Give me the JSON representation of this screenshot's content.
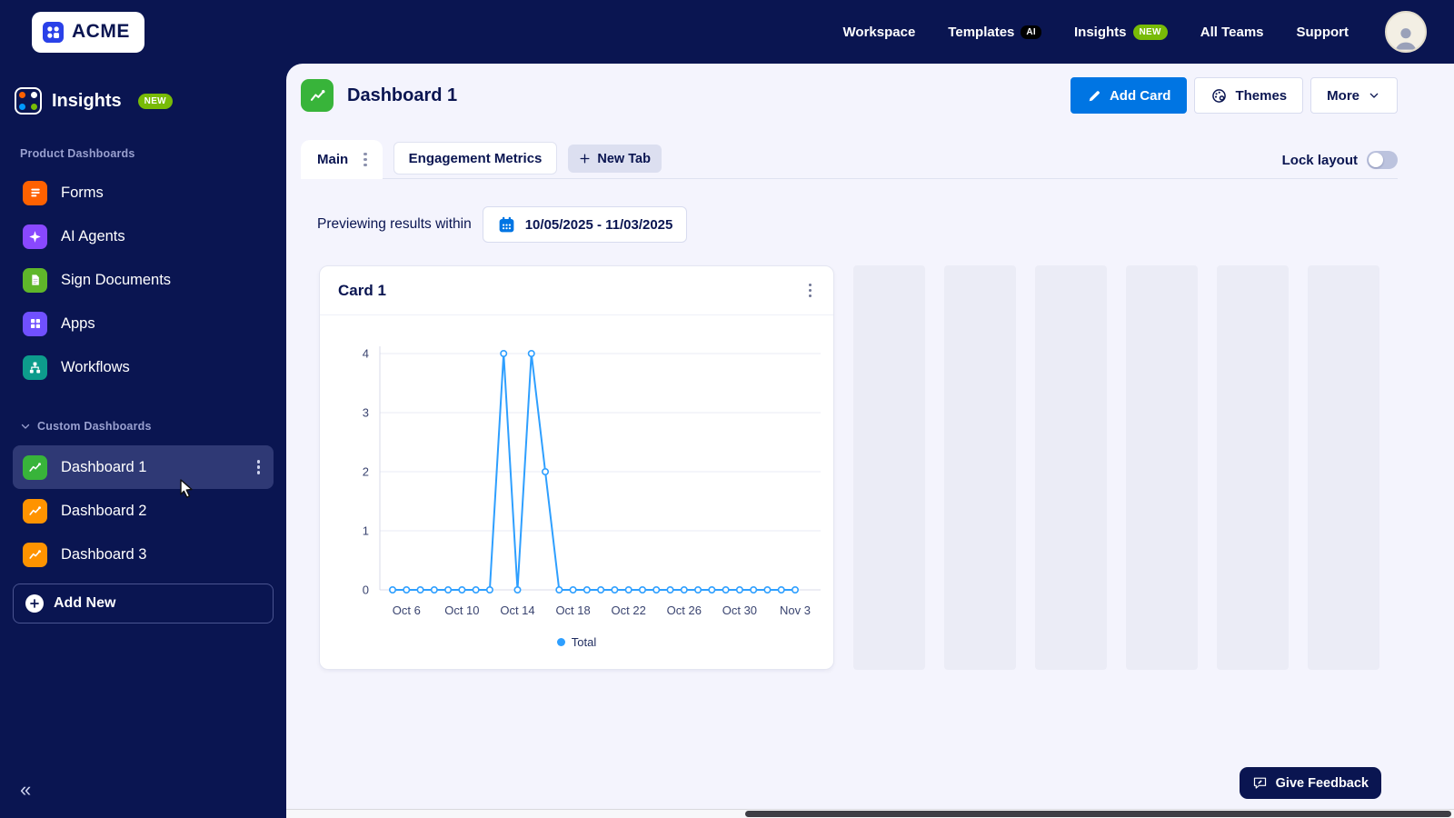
{
  "topbar": {
    "brand": "ACME",
    "nav": [
      {
        "label": "Workspace"
      },
      {
        "label": "Templates",
        "badge": "AI"
      },
      {
        "label": "Insights",
        "badge": "NEW"
      },
      {
        "label": "All Teams"
      },
      {
        "label": "Support"
      }
    ]
  },
  "sidebar": {
    "product": "Insights",
    "product_badge": "NEW",
    "section1": "Product Dashboards",
    "items": [
      {
        "label": "Forms",
        "icon": "forms-icon",
        "color": "#ff6100"
      },
      {
        "label": "AI Agents",
        "icon": "ai-agents-icon",
        "color": "#8948ff"
      },
      {
        "label": "Sign Documents",
        "icon": "sign-documents-icon",
        "color": "#5fb62a"
      },
      {
        "label": "Apps",
        "icon": "apps-icon",
        "color": "#7050ff"
      },
      {
        "label": "Workflows",
        "icon": "workflows-icon",
        "color": "#0d9c8c"
      }
    ],
    "section2": "Custom Dashboards",
    "dashboards": [
      {
        "label": "Dashboard 1",
        "icon": "dashboard-icon",
        "color": "#38b43a",
        "active": true
      },
      {
        "label": "Dashboard 2",
        "icon": "dashboard-icon",
        "color": "#ff9300",
        "active": false
      },
      {
        "label": "Dashboard 3",
        "icon": "dashboard-icon",
        "color": "#ff9300",
        "active": false
      }
    ],
    "add_new": "Add New",
    "collapse": "«"
  },
  "header": {
    "title": "Dashboard 1",
    "icon_color": "#38b43a",
    "add_card": "Add Card",
    "themes": "Themes",
    "more": "More"
  },
  "tabs": {
    "main_label": "Main",
    "metrics_label": "Engagement Metrics",
    "new_tab_label": "New Tab",
    "lock_label": "Lock layout",
    "lock_on": false
  },
  "preview": {
    "label": "Previewing results within",
    "date_range": "10/05/2025 - 11/03/2025"
  },
  "card": {
    "title": "Card 1"
  },
  "chart_data": {
    "type": "line",
    "title": "Card 1",
    "x": [
      "Oct 5",
      "Oct 6",
      "Oct 7",
      "Oct 8",
      "Oct 9",
      "Oct 10",
      "Oct 11",
      "Oct 12",
      "Oct 13",
      "Oct 14",
      "Oct 15",
      "Oct 16",
      "Oct 17",
      "Oct 18",
      "Oct 19",
      "Oct 20",
      "Oct 21",
      "Oct 22",
      "Oct 23",
      "Oct 24",
      "Oct 25",
      "Oct 26",
      "Oct 27",
      "Oct 28",
      "Oct 29",
      "Oct 30",
      "Oct 31",
      "Nov 1",
      "Nov 2",
      "Nov 3"
    ],
    "series": [
      {
        "name": "Total",
        "values": [
          0,
          0,
          0,
          0,
          0,
          0,
          0,
          0,
          4,
          0,
          4,
          2,
          0,
          0,
          0,
          0,
          0,
          0,
          0,
          0,
          0,
          0,
          0,
          0,
          0,
          0,
          0,
          0,
          0,
          0
        ]
      }
    ],
    "x_tick_labels": [
      "Oct 6",
      "Oct 10",
      "Oct 14",
      "Oct 18",
      "Oct 22",
      "Oct 26",
      "Oct 30",
      "Nov 3"
    ],
    "y_ticks": [
      0,
      1,
      2,
      3,
      4
    ],
    "ylim": [
      0,
      4
    ],
    "line_color": "#2e9fff",
    "grid": true,
    "legend_position": "bottom"
  },
  "feedback": "Give Feedback",
  "colors": {
    "navy": "#0a1551",
    "content_bg": "#f4f4fd",
    "accent_blue": "#0075e3",
    "badge_green": "#78bb07",
    "chart_line": "#2e9fff",
    "sidebar_active": "#2f3975"
  }
}
